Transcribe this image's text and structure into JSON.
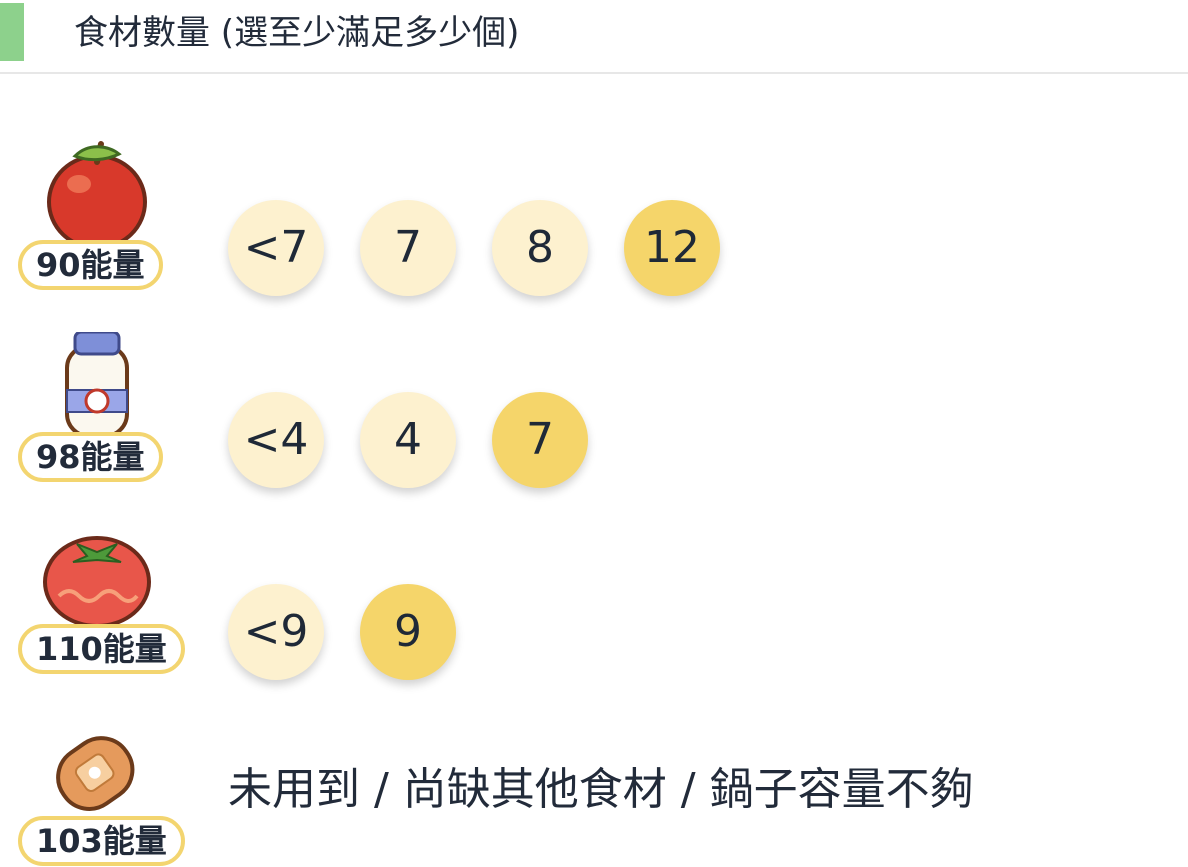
{
  "header": {
    "accent_color": "#8dd18c",
    "title": "食材數量 (選至少滿足多少個)"
  },
  "colors": {
    "option_default": "#fdf1cf",
    "option_selected": "#f5d56a",
    "energy_border": "#f3d570"
  },
  "ingredients": [
    {
      "icon": "apple-icon",
      "energy": "90能量",
      "options": [
        {
          "label": "<7",
          "selected": false
        },
        {
          "label": "7",
          "selected": false
        },
        {
          "label": "8",
          "selected": false
        },
        {
          "label": "12",
          "selected": true
        }
      ]
    },
    {
      "icon": "milk-bottle-icon",
      "energy": "98能量",
      "options": [
        {
          "label": "<4",
          "selected": false
        },
        {
          "label": "4",
          "selected": false
        },
        {
          "label": "7",
          "selected": true
        }
      ]
    },
    {
      "icon": "tomato-icon",
      "energy": "110能量",
      "options": [
        {
          "label": "<9",
          "selected": false
        },
        {
          "label": "9",
          "selected": true
        }
      ]
    },
    {
      "icon": "potato-icon",
      "energy": "103能量",
      "status": "未用到 / 尚缺其他食材 / 鍋子容量不夠"
    }
  ]
}
